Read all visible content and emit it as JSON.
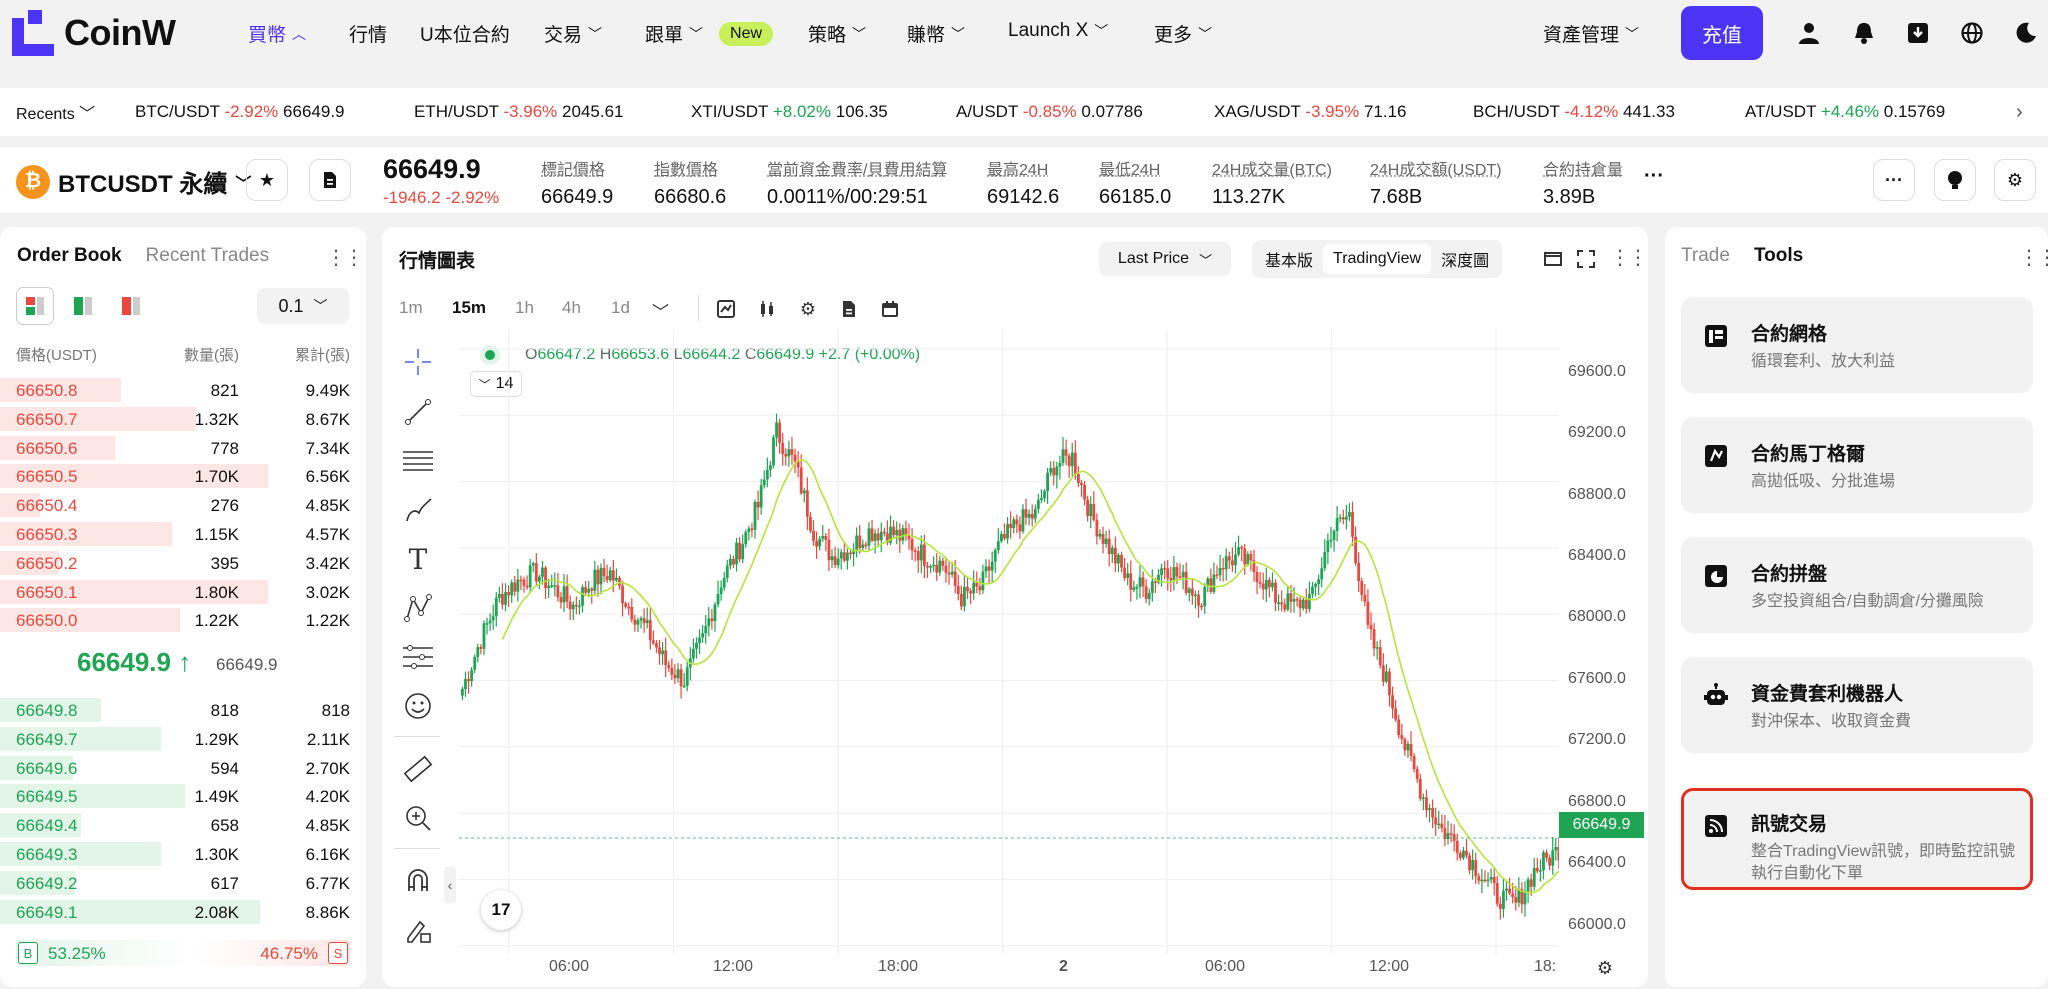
{
  "brand": "CoinW",
  "nav": {
    "items": [
      "買幣",
      "行情",
      "U本位合約",
      "交易",
      "跟單",
      "策略",
      "賺幣",
      "Launch X",
      "更多"
    ],
    "new_badge": "New",
    "asset_mgmt": "資產管理",
    "deposit": "充值"
  },
  "ticker": {
    "recents": "Recents",
    "items": [
      {
        "pair": "BTC/USDT",
        "change": "-2.92%",
        "price": "66649.9"
      },
      {
        "pair": "ETH/USDT",
        "change": "-3.96%",
        "price": "2045.61"
      },
      {
        "pair": "XTI/USDT",
        "change": "+8.02%",
        "price": "106.35"
      },
      {
        "pair": "A/USDT",
        "change": "-0.85%",
        "price": "0.07786"
      },
      {
        "pair": "XAG/USDT",
        "change": "-3.95%",
        "price": "71.16"
      },
      {
        "pair": "BCH/USDT",
        "change": "-4.12%",
        "price": "441.33"
      },
      {
        "pair": "AT/USDT",
        "change": "+4.46%",
        "price": "0.15769"
      }
    ]
  },
  "symbol": {
    "name": "BTCUSDT 永續",
    "last": "66649.9",
    "change": "-1946.2 -2.92%",
    "stats": [
      {
        "label": "標記價格",
        "value": "66649.9"
      },
      {
        "label": "指數價格",
        "value": "66680.6"
      },
      {
        "label": "當前資金費率/貝費用結算",
        "value": "0.0011%/00:29:51"
      },
      {
        "label": "最高24H",
        "value": "69142.6"
      },
      {
        "label": "最低24H",
        "value": "66185.0"
      },
      {
        "label": "24H成交量(BTC)",
        "value": "113.27K"
      },
      {
        "label": "24H成交額(USDT)",
        "value": "7.68B"
      },
      {
        "label": "合約持倉量",
        "value": "3.89B"
      }
    ]
  },
  "orderbook": {
    "tabs": [
      "Order Book",
      "Recent Trades"
    ],
    "precision": "0.1",
    "headers": [
      "價格(USDT)",
      "數量(張)",
      "累計(張)"
    ],
    "asks": [
      {
        "price": "66650.8",
        "qty": "821",
        "total": "9.49K",
        "depth": 0.45
      },
      {
        "price": "66650.7",
        "qty": "1.32K",
        "total": "8.67K",
        "depth": 0.73
      },
      {
        "price": "66650.6",
        "qty": "778",
        "total": "7.34K",
        "depth": 0.43
      },
      {
        "price": "66650.5",
        "qty": "1.70K",
        "total": "6.56K",
        "depth": 1.0
      },
      {
        "price": "66650.4",
        "qty": "276",
        "total": "4.85K",
        "depth": 0.15
      },
      {
        "price": "66650.3",
        "qty": "1.15K",
        "total": "4.57K",
        "depth": 0.64
      },
      {
        "price": "66650.2",
        "qty": "395",
        "total": "3.42K",
        "depth": 0.22
      },
      {
        "price": "66650.1",
        "qty": "1.80K",
        "total": "3.02K",
        "depth": 1.0
      },
      {
        "price": "66650.0",
        "qty": "1.22K",
        "total": "1.22K",
        "depth": 0.67
      }
    ],
    "mid_price": "66649.9",
    "mid_arrow": "↑",
    "mark": "66649.9",
    "bids": [
      {
        "price": "66649.8",
        "qty": "818",
        "total": "818",
        "depth": 0.39
      },
      {
        "price": "66649.7",
        "qty": "1.29K",
        "total": "2.11K",
        "depth": 0.62
      },
      {
        "price": "66649.6",
        "qty": "594",
        "total": "2.70K",
        "depth": 0.28
      },
      {
        "price": "66649.5",
        "qty": "1.49K",
        "total": "4.20K",
        "depth": 0.71
      },
      {
        "price": "66649.4",
        "qty": "658",
        "total": "4.85K",
        "depth": 0.31
      },
      {
        "price": "66649.3",
        "qty": "1.30K",
        "total": "6.16K",
        "depth": 0.62
      },
      {
        "price": "66649.2",
        "qty": "617",
        "total": "6.77K",
        "depth": 0.29
      },
      {
        "price": "66649.1",
        "qty": "2.08K",
        "total": "8.86K",
        "depth": 1.0
      }
    ],
    "buy_pct": "53.25%",
    "sell_pct": "46.75%",
    "buy_label": "B",
    "sell_label": "S"
  },
  "chart": {
    "title": "行情圖表",
    "price_type": "Last Price",
    "views": [
      "基本版",
      "TradingView",
      "深度圖"
    ],
    "timeframes": [
      "1m",
      "15m",
      "1h",
      "4h",
      "1d"
    ],
    "ohlc": {
      "o": "66647.2",
      "h": "66653.6",
      "l": "66644.2",
      "c": "66649.9",
      "chg": "+2.7 (+0.00%)"
    },
    "indicator": "14",
    "y_ticks": [
      "69600.0",
      "69200.0",
      "68800.0",
      "68400.0",
      "68000.0",
      "67600.0",
      "67200.0",
      "66800.0",
      "66400.0",
      "66000.0"
    ],
    "x_ticks": [
      "06:00",
      "12:00",
      "18:00",
      "2",
      "06:00",
      "12:00",
      "18:"
    ],
    "current": "66649.9",
    "colors": {
      "up": "#1ea453",
      "down": "#e8483d",
      "ma": "#b3e63b"
    }
  },
  "chart_data": {
    "type": "candlestick",
    "interval": "15m",
    "ylim": [
      65950,
      69720
    ],
    "y_ticks": [
      69600,
      69200,
      68800,
      68400,
      68000,
      67600,
      67200,
      66800,
      66400,
      66000
    ],
    "x_ticks": [
      "06:00",
      "12:00",
      "18:00",
      "2",
      "06:00",
      "12:00",
      "18:"
    ],
    "close_path": [
      [
        0,
        67550
      ],
      [
        6,
        67850
      ],
      [
        12,
        68100
      ],
      [
        18,
        68200
      ],
      [
        24,
        68250
      ],
      [
        30,
        68150
      ],
      [
        36,
        68050
      ],
      [
        42,
        68200
      ],
      [
        48,
        68250
      ],
      [
        54,
        68050
      ],
      [
        60,
        67900
      ],
      [
        66,
        67700
      ],
      [
        72,
        67600
      ],
      [
        78,
        67850
      ],
      [
        84,
        68200
      ],
      [
        90,
        68400
      ],
      [
        96,
        68650
      ],
      [
        102,
        69100
      ],
      [
        108,
        68900
      ],
      [
        114,
        68500
      ],
      [
        120,
        68350
      ],
      [
        126,
        68400
      ],
      [
        132,
        68500
      ],
      [
        138,
        68500
      ],
      [
        144,
        68450
      ],
      [
        150,
        68350
      ],
      [
        156,
        68300
      ],
      [
        162,
        68100
      ],
      [
        168,
        68150
      ],
      [
        174,
        68400
      ],
      [
        180,
        68550
      ],
      [
        186,
        68600
      ],
      [
        192,
        68900
      ],
      [
        198,
        68950
      ],
      [
        204,
        68600
      ],
      [
        210,
        68400
      ],
      [
        216,
        68200
      ],
      [
        222,
        68150
      ],
      [
        228,
        68300
      ],
      [
        234,
        68200
      ],
      [
        240,
        68100
      ],
      [
        246,
        68300
      ],
      [
        252,
        68350
      ],
      [
        258,
        68250
      ],
      [
        264,
        68100
      ],
      [
        270,
        68050
      ],
      [
        276,
        68100
      ],
      [
        282,
        68500
      ],
      [
        288,
        68600
      ],
      [
        294,
        67900
      ],
      [
        300,
        67600
      ],
      [
        306,
        67200
      ],
      [
        312,
        66900
      ],
      [
        318,
        66700
      ],
      [
        324,
        66600
      ],
      [
        330,
        66450
      ],
      [
        336,
        66300
      ],
      [
        342,
        66250
      ],
      [
        348,
        66450
      ],
      [
        354,
        66550
      ],
      [
        360,
        66650
      ]
    ],
    "ma_period": 14,
    "last_price": 66649.9,
    "ohlc_last": {
      "open": 66647.2,
      "high": 66653.6,
      "low": 66644.2,
      "close": 66649.9
    }
  },
  "tools": {
    "tabs": [
      "Trade",
      "Tools"
    ],
    "cards": [
      {
        "title": "合約網格",
        "desc": "循環套利、放大利益"
      },
      {
        "title": "合約馬丁格爾",
        "desc": "高拋低吸、分批進場"
      },
      {
        "title": "合約拼盤",
        "desc": "多空投資組合/自動調倉/分攤風險"
      },
      {
        "title": "資金費套利機器人",
        "desc": "對沖保本、收取資金費"
      },
      {
        "title": "訊號交易",
        "desc": "整合TradingView訊號，即時監控訊號執行自動化下單"
      }
    ]
  }
}
